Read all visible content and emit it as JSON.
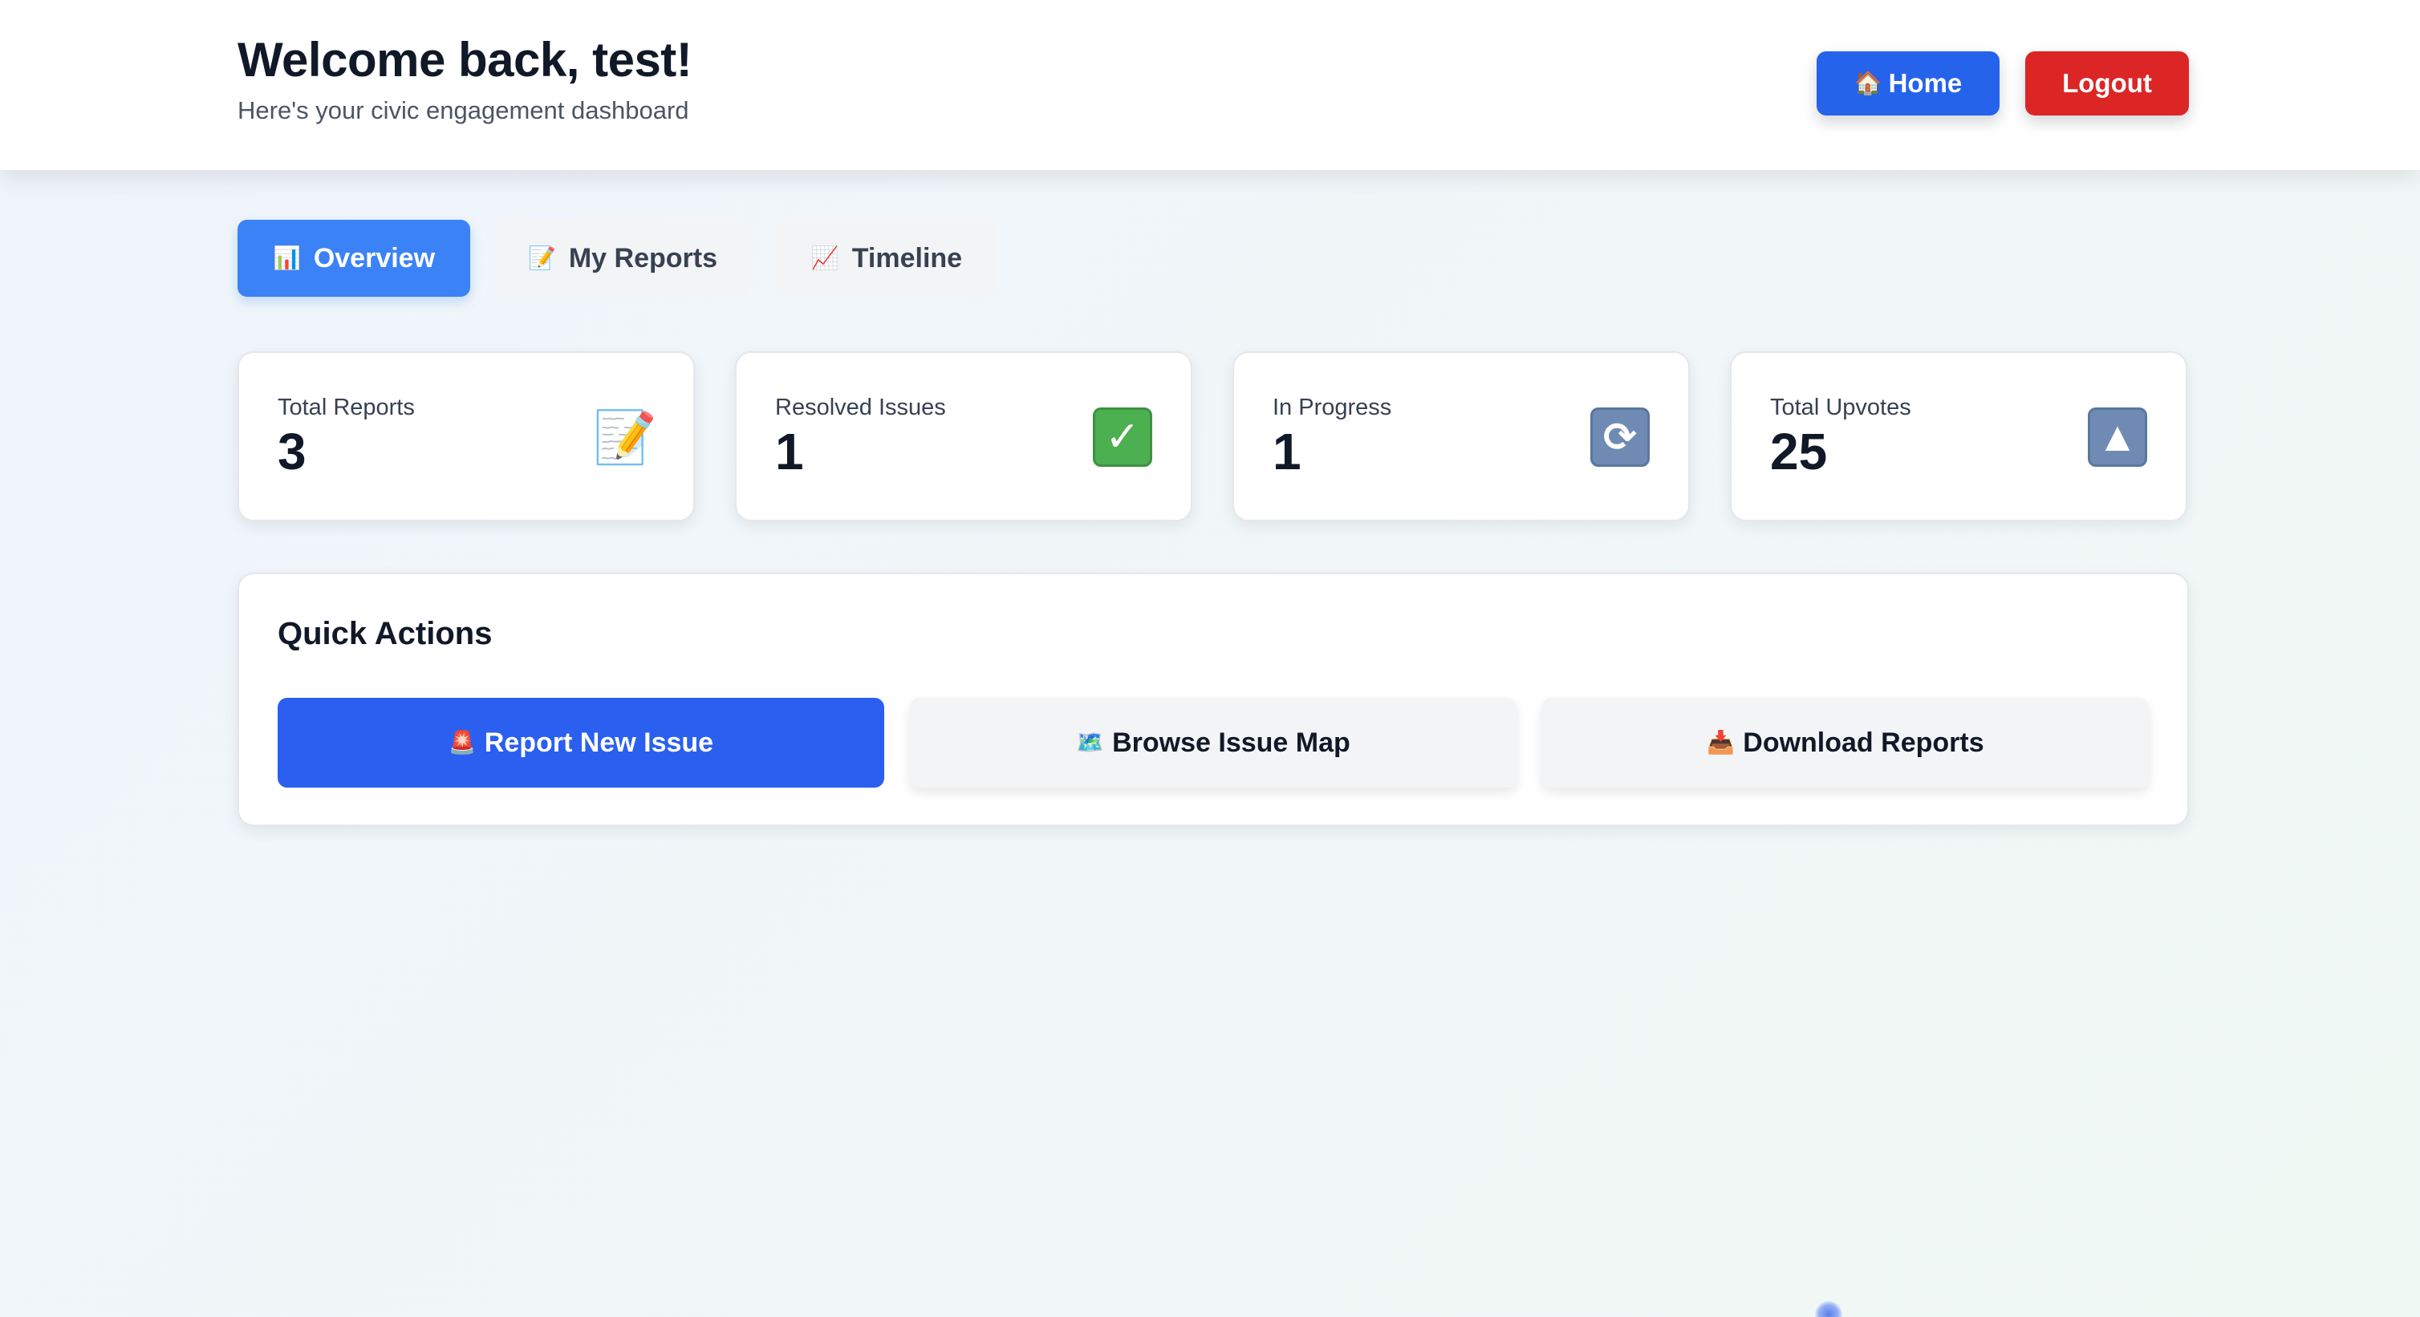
{
  "header": {
    "title": "Welcome back, test!",
    "subtitle": "Here's your civic engagement dashboard",
    "home_icon": "🏠",
    "home_label": "Home",
    "logout_label": "Logout"
  },
  "tabs": [
    {
      "icon": "📊",
      "label": "Overview",
      "active": true
    },
    {
      "icon": "📝",
      "label": "My Reports",
      "active": false
    },
    {
      "icon": "📈",
      "label": "Timeline",
      "active": false
    }
  ],
  "stats": [
    {
      "label": "Total Reports",
      "value": "3",
      "icon": "memo-icon",
      "glyph": "📝"
    },
    {
      "label": "Resolved Issues",
      "value": "1",
      "icon": "check-icon",
      "glyph": "✓"
    },
    {
      "label": "In Progress",
      "value": "1",
      "icon": "refresh-icon",
      "glyph": "⟳"
    },
    {
      "label": "Total Upvotes",
      "value": "25",
      "icon": "upvote-icon",
      "glyph": "▲"
    }
  ],
  "quick_actions": {
    "title": "Quick Actions",
    "items": [
      {
        "icon": "🚨",
        "label": "Report New Issue"
      },
      {
        "icon": "🗺️",
        "label": "Browse Issue Map"
      },
      {
        "icon": "📥",
        "label": "Download Reports"
      }
    ]
  },
  "colors": {
    "primary": "#2563eb",
    "danger": "#dc2626",
    "tab_active": "#3b82f6"
  }
}
